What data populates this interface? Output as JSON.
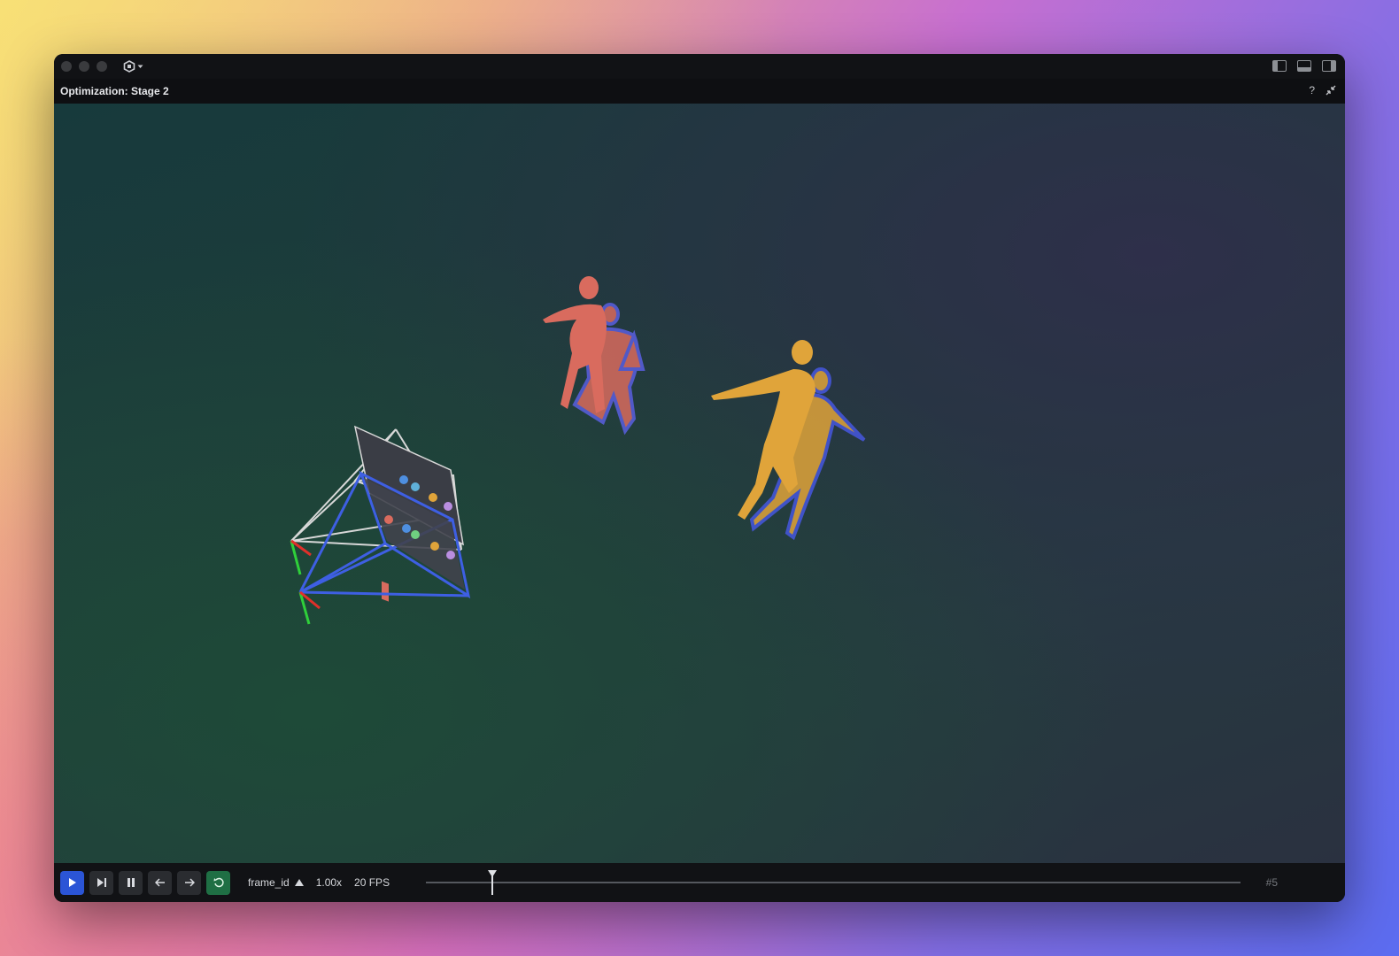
{
  "window": {
    "panel_title": "Optimization: Stage 2",
    "help_label": "?",
    "icons": [
      "app-logo-icon",
      "layout-left-icon",
      "layout-bottom-icon",
      "layout-right-icon",
      "collapse-icon"
    ]
  },
  "viewport": {
    "objects": [
      "camera-frustum-gt",
      "camera-frustum-estimated",
      "human-mesh-red",
      "human-mesh-yellow"
    ],
    "colors": {
      "red_mesh": "#d96b5e",
      "yellow_mesh": "#e0a43a",
      "outline": "#3b5be0",
      "frustum_white": "#d8d8d8",
      "frustum_blue": "#3e5fe3"
    }
  },
  "timeline": {
    "selector_label": "frame_id",
    "speed": "1.00x",
    "fps": "20 FPS",
    "frame_display": "#5",
    "playhead_progress": 0.08,
    "buttons": [
      "play",
      "step-forward",
      "pause",
      "prev",
      "next",
      "loop"
    ]
  }
}
